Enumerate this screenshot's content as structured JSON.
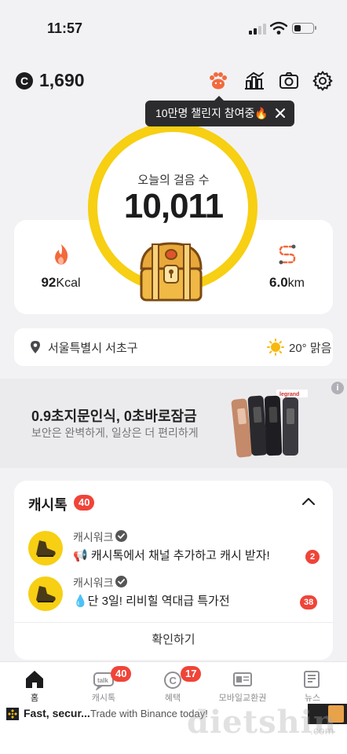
{
  "status_bar": {
    "time": "11:57"
  },
  "header": {
    "coin_symbol": "C",
    "coin_amount": "1,690",
    "icons": [
      "paw-icon",
      "stats-icon",
      "camera-icon",
      "gear-icon"
    ]
  },
  "tooltip": {
    "text": "10만명 챌린지 참여중🔥"
  },
  "steps": {
    "label": "오늘의 걸음 수",
    "value": "10,011"
  },
  "stats": {
    "calories": {
      "value": "92",
      "unit": "Kcal"
    },
    "distance": {
      "value": "6.0",
      "unit": "km"
    }
  },
  "location": {
    "place": "서울특별시 서초구",
    "weather": "20° 맑음"
  },
  "ad": {
    "title": "0.9초지문인식, 0초바로잠금",
    "subtitle": "보안은 완벽하게, 일상은 더 편리하게",
    "info": "i",
    "brand": "legrand"
  },
  "cashtalk": {
    "title": "캐시톡",
    "count": "40",
    "messages": [
      {
        "sender": "캐시워크",
        "text": "📢 캐시톡에서 채널 추가하고 캐시 받자!",
        "badge": "2"
      },
      {
        "sender": "캐시워크",
        "text": "💧단 3일! 리비힐 역대급 특가전",
        "badge": "38"
      }
    ],
    "confirm_label": "확인하기"
  },
  "tabs": [
    {
      "label": "홈",
      "badge": ""
    },
    {
      "label": "캐시톡",
      "badge": "40"
    },
    {
      "label": "혜택",
      "badge": "17"
    },
    {
      "label": "모바일교환권",
      "badge": ""
    },
    {
      "label": "뉴스",
      "badge": ""
    }
  ],
  "bottom_ad": {
    "title": "Fast, secur...",
    "subtitle": "Trade with Binance today!"
  },
  "watermark": {
    "text": "dietshin",
    "suffix": ".com"
  },
  "colors": {
    "accent_yellow": "#f7cf13",
    "badge_red": "#f04438",
    "paw_orange": "#f26a3d"
  }
}
